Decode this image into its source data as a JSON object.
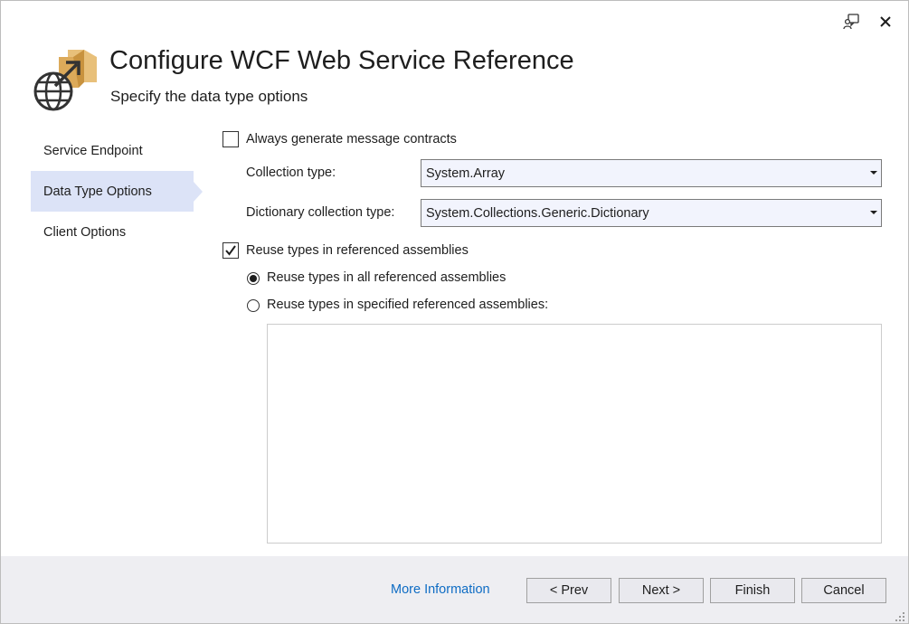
{
  "header": {
    "title": "Configure WCF Web Service Reference",
    "subtitle": "Specify the data type options"
  },
  "nav": {
    "items": [
      {
        "label": "Service Endpoint"
      },
      {
        "label": "Data Type Options",
        "selected": true
      },
      {
        "label": "Client Options"
      }
    ]
  },
  "options": {
    "message_contracts": {
      "label": "Always generate message contracts",
      "checked": false
    },
    "collection_type": {
      "label": "Collection type:",
      "value": "System.Array"
    },
    "dictionary_type": {
      "label": "Dictionary collection type:",
      "value": "System.Collections.Generic.Dictionary"
    },
    "reuse_types": {
      "label": "Reuse types in referenced assemblies",
      "checked": true
    },
    "reuse_all": {
      "label": "Reuse types in all referenced assemblies",
      "selected": true
    },
    "reuse_specified": {
      "label": "Reuse types in specified referenced assemblies:",
      "selected": false
    },
    "assemblies": []
  },
  "footer": {
    "more_info": "More Information",
    "prev": "< Prev",
    "next": "Next >",
    "finish": "Finish",
    "cancel": "Cancel"
  },
  "icons": {
    "feedback": "feedback-icon",
    "close": "close-icon",
    "hero": "globe-web-service-icon",
    "resize": "resize-grip-icon"
  },
  "colors": {
    "nav_selected_bg": "#dce3f7",
    "link": "#0e6cc4",
    "footer_bg": "#eeeef2",
    "combo_bg": "#f2f4fd",
    "hero_folder": "#dcaa5a"
  }
}
